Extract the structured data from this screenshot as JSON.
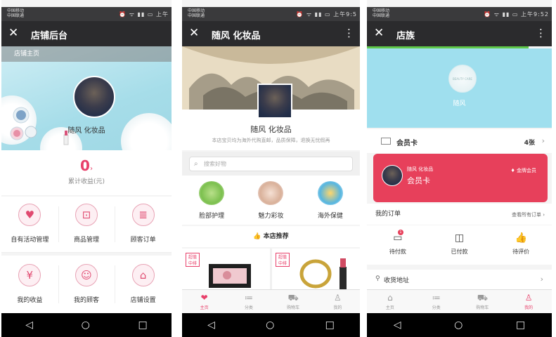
{
  "system": {
    "carrier_line1": "中国移动",
    "carrier_line2": "中国联通",
    "status_icons": "⏰ ᯤ ▮▮ ▭",
    "time1": "上午",
    "time2": "上午9:5",
    "time3": "上午9:52"
  },
  "phone1": {
    "title": "店铺后台",
    "banner_sub": "店铺主页",
    "store_name": "随风 化妆品",
    "earnings_value": "0",
    "earnings_label": "累计收益(元)",
    "grid_row1": [
      {
        "label": "自有活动管理",
        "icon": "♥"
      },
      {
        "label": "商品管理",
        "icon": "⊡"
      },
      {
        "label": "顾客订单",
        "icon": "≣"
      }
    ],
    "grid_row2": [
      {
        "label": "我的收益",
        "icon": "¥"
      },
      {
        "label": "我的顾客",
        "icon": "☺"
      },
      {
        "label": "店铺设置",
        "icon": "⌂"
      }
    ]
  },
  "phone2": {
    "title": "随风 化妆品",
    "store_name": "随风 化妆品",
    "description": "本店宝贝均为海外代购直邮，品质保障，退换无忧假再",
    "search_placeholder": "搜索好物",
    "categories": [
      {
        "label": "脸部护理"
      },
      {
        "label": "魅力彩妆"
      },
      {
        "label": "海外保健"
      }
    ],
    "recommend_label": "本店推荐",
    "badge_line1": "超值",
    "badge_line2": "中排",
    "tabs": [
      {
        "label": "主页",
        "icon": "❤"
      },
      {
        "label": "分类",
        "icon": "≔"
      },
      {
        "label": "购物车",
        "icon": "⛟"
      },
      {
        "label": "我的",
        "icon": "♙"
      }
    ]
  },
  "phone3": {
    "title": "店族",
    "logo_text": "BEAUTY CARE",
    "store_name": "随风",
    "card_label": "会员卡",
    "card_count": "4张",
    "member_store": "随风 化妆品",
    "member_card": "会员卡",
    "member_level": "金牌会员",
    "orders_label": "我的订单",
    "orders_all": "查看所有订单",
    "order_items": [
      {
        "label": "待付款",
        "icon": "▭",
        "badge": "1"
      },
      {
        "label": "已付款",
        "icon": "◫",
        "badge": ""
      },
      {
        "label": "待评价",
        "icon": "👍",
        "badge": ""
      }
    ],
    "address_label": "收货地址",
    "tabs": [
      {
        "label": "主页",
        "icon": "⌂"
      },
      {
        "label": "分类",
        "icon": "≔"
      },
      {
        "label": "购物车",
        "icon": "⛟"
      },
      {
        "label": "我的",
        "icon": "♙"
      }
    ]
  },
  "colors": {
    "accent": "#e8406a",
    "topbar": "#2b2b2d",
    "member_card": "#e7405b",
    "banner": "#a6dde9"
  }
}
